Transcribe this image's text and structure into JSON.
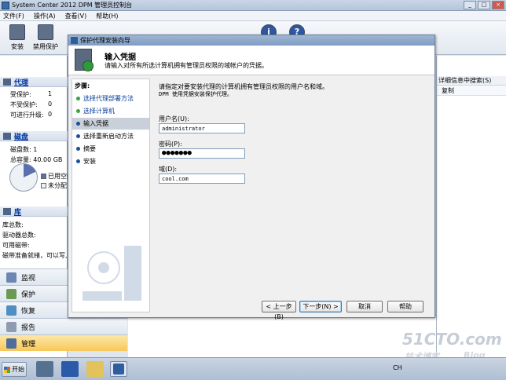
{
  "window": {
    "title": "System Center 2012 DPM 管理员控制台",
    "controls": [
      "_",
      "□",
      "×"
    ]
  },
  "menu": [
    "文件(F)",
    "操作(A)",
    "查看(V)",
    "帮助(H)"
  ],
  "toolbar": {
    "install_label": "安装",
    "disable_label": "禁用保护"
  },
  "agents": {
    "title": "代理",
    "rows": [
      {
        "label": "受保护:",
        "value": "1"
      },
      {
        "label": "不受保护:",
        "value": "0"
      },
      {
        "label": "可进行升级:",
        "value": "0"
      }
    ]
  },
  "disks": {
    "title": "磁盘",
    "count_label": "磁盘数:",
    "count_value": "1",
    "capacity_label": "总容量:",
    "capacity_value": "40.00 GB",
    "legend_used": "已用空间",
    "legend_unalloc": "未分配",
    "used_fraction": 0.18
  },
  "library": {
    "title": "库",
    "rows": [
      "库总数:",
      "驱动器总数:",
      "可用磁带:",
      "磁带准备就绪，可以写入"
    ]
  },
  "nav": [
    {
      "label": "监视"
    },
    {
      "label": "保护"
    },
    {
      "label": "恢复"
    },
    {
      "label": "报告"
    },
    {
      "label": "管理"
    }
  ],
  "right_pane": {
    "search_text": "详细信息中搜索(S)",
    "col_text": "复制"
  },
  "dialog": {
    "title": "保护代理安装向导",
    "header_title": "输入凭据",
    "header_sub": "请输入对所有所选计算机拥有管理员权限的域帐户的凭据。",
    "steps_header": "步骤:",
    "steps": [
      {
        "label": "选择代理部署方法",
        "state": "done"
      },
      {
        "label": "选择计算机",
        "state": "done"
      },
      {
        "label": "输入凭据",
        "state": "current"
      },
      {
        "label": "选择重新启动方法",
        "state": "todo"
      },
      {
        "label": "摘要",
        "state": "todo"
      },
      {
        "label": "安装",
        "state": "todo"
      }
    ],
    "desc1": "请指定对要安装代理的计算机拥有管理员权限的用户名和域。",
    "desc2": "DPM 使用凭据安装保护代理。",
    "username_label": "用户名(U):",
    "username_value": "administrator",
    "password_label": "密码(P):",
    "password_value": "●●●●●●●",
    "domain_label": "域(D):",
    "domain_value": "cool.com",
    "buttons": {
      "back": "< 上一步(B)",
      "next": "下一步(N) >",
      "cancel": "取消",
      "help": "帮助"
    }
  },
  "taskbar": {
    "start_label": "开始",
    "tray_lang": "CH"
  },
  "watermark": {
    "site": "51CTO.com",
    "sub": "技术博客",
    "blog": "Blog"
  }
}
